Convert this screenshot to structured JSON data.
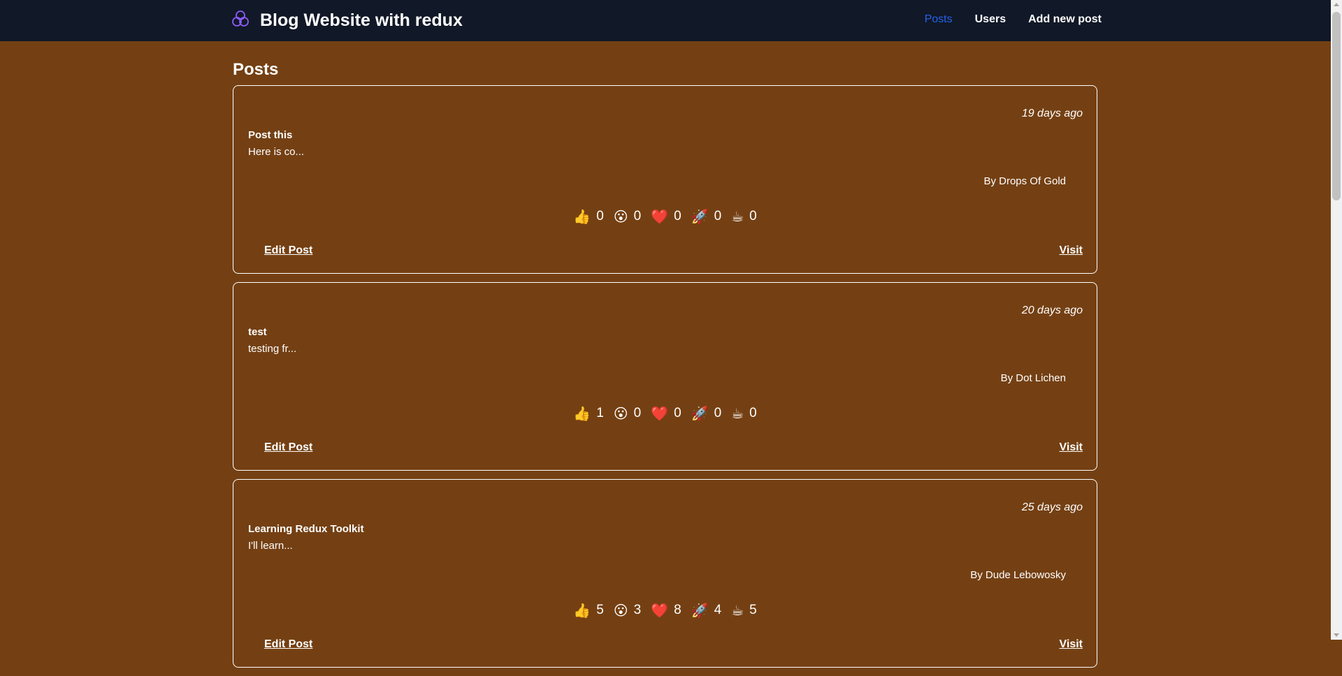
{
  "header": {
    "brand": "Blog Website with redux",
    "brand_icon": "logo-icon",
    "nav": [
      {
        "label": "Posts",
        "active": true
      },
      {
        "label": "Users",
        "active": false
      },
      {
        "label": "Add new post",
        "active": false
      }
    ],
    "active_color": "#2563eb",
    "bg_color": "#111827"
  },
  "main": {
    "title": "Posts",
    "bg_color": "#744013",
    "posts": [
      {
        "time": "19 days ago",
        "title": "Post this",
        "excerpt": "Here is co...",
        "author": "By Drops Of Gold",
        "reactions": [
          {
            "emoji": "👍",
            "count": "0"
          },
          {
            "emoji": "😮",
            "count": "0"
          },
          {
            "emoji": "❤️",
            "count": "0"
          },
          {
            "emoji": "🚀",
            "count": "0"
          },
          {
            "emoji": "☕",
            "count": "0"
          }
        ],
        "edit_label": "Edit Post",
        "visit_label": "Visit"
      },
      {
        "time": "20 days ago",
        "title": "test",
        "excerpt": "testing fr...",
        "author": "By Dot Lichen",
        "reactions": [
          {
            "emoji": "👍",
            "count": "1"
          },
          {
            "emoji": "😮",
            "count": "0"
          },
          {
            "emoji": "❤️",
            "count": "0"
          },
          {
            "emoji": "🚀",
            "count": "0"
          },
          {
            "emoji": "☕",
            "count": "0"
          }
        ],
        "edit_label": "Edit Post",
        "visit_label": "Visit"
      },
      {
        "time": "25 days ago",
        "title": "Learning Redux Toolkit",
        "excerpt": "I'll learn...",
        "author": "By Dude Lebowosky",
        "reactions": [
          {
            "emoji": "👍",
            "count": "5"
          },
          {
            "emoji": "😮",
            "count": "3"
          },
          {
            "emoji": "❤️",
            "count": "8"
          },
          {
            "emoji": "🚀",
            "count": "4"
          },
          {
            "emoji": "☕",
            "count": "5"
          }
        ],
        "edit_label": "Edit Post",
        "visit_label": "Visit"
      }
    ]
  }
}
